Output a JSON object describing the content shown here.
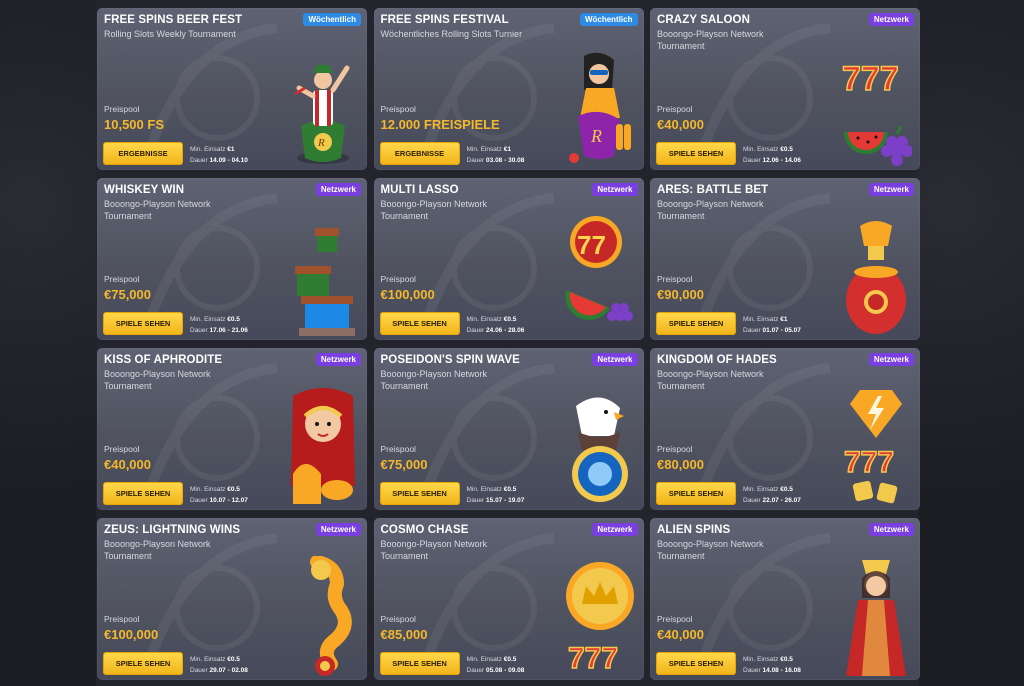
{
  "labels": {
    "pool": "Preispool",
    "min_bet": "Min. Einsatz",
    "duration": "Dauer"
  },
  "cards": [
    {
      "title": "FREE SPINS BEER FEST",
      "subtitle": "Rolling Slots Weekly Tournament",
      "badge": "Wöchentlich",
      "badge_type": "weekly",
      "pool": "10,500 FS",
      "button": "ERGEBNISSE",
      "min_bet": "€1",
      "duration": "14.09 - 04.10",
      "art": "beer-mascot"
    },
    {
      "title": "FREE SPINS FESTIVAL",
      "subtitle": "Wöchentliches Rolling Slots Turnier",
      "badge": "Wöchentlich",
      "badge_type": "weekly",
      "pool": "12.000 FREISPIELE",
      "button": "ERGEBNISSE",
      "min_bet": "€1",
      "duration": "03.08 - 30.08",
      "art": "festival-mascot"
    },
    {
      "title": "CRAZY SALOON",
      "subtitle": "Booongo-Playson Network Tournament",
      "badge": "Netzwerk",
      "badge_type": "network",
      "pool": "€40,000",
      "button": "SPIELE SEHEN",
      "min_bet": "€0.5",
      "duration": "12.06 - 14.06",
      "art": "sevens-fruits"
    },
    {
      "title": "WHISKEY WIN",
      "subtitle": "Booongo-Playson Network Tournament",
      "badge": "Netzwerk",
      "badge_type": "network",
      "pool": "€75,000",
      "button": "SPIELE SEHEN",
      "min_bet": "€0.5",
      "duration": "17.06 - 21.06",
      "art": "temple"
    },
    {
      "title": "MULTI LASSO",
      "subtitle": "Booongo-Playson Network Tournament",
      "badge": "Netzwerk",
      "badge_type": "network",
      "pool": "€100,000",
      "button": "SPIELE SEHEN",
      "min_bet": "€0.5",
      "duration": "24.06 - 28.06",
      "art": "sevens-watermelon"
    },
    {
      "title": "ARES: BATTLE BET",
      "subtitle": "Booongo-Playson Network Tournament",
      "badge": "Netzwerk",
      "badge_type": "network",
      "pool": "€90,000",
      "button": "SPIELE SEHEN",
      "min_bet": "€1",
      "duration": "01.07 - 05.07",
      "art": "dragon-vase"
    },
    {
      "title": "KISS OF APHRODITE",
      "subtitle": "Booongo-Playson Network Tournament",
      "badge": "Netzwerk",
      "badge_type": "network",
      "pool": "€40,000",
      "button": "SPIELE SEHEN",
      "min_bet": "€0.5",
      "duration": "10.07 - 12.07",
      "art": "goddess"
    },
    {
      "title": "POSEIDON'S SPIN WAVE",
      "subtitle": "Booongo-Playson Network Tournament",
      "badge": "Netzwerk",
      "badge_type": "network",
      "pool": "€75,000",
      "button": "SPIELE SEHEN",
      "min_bet": "€0.5",
      "duration": "15.07 - 19.07",
      "art": "eagle-orb"
    },
    {
      "title": "KINGDOM OF HADES",
      "subtitle": "Booongo-Playson Network Tournament",
      "badge": "Netzwerk",
      "badge_type": "network",
      "pool": "€80,000",
      "button": "SPIELE SEHEN",
      "min_bet": "€0.5",
      "duration": "22.07 - 26.07",
      "art": "lightning-sevens"
    },
    {
      "title": "ZEUS: LIGHTNING WINS",
      "subtitle": "Booongo-Playson Network Tournament",
      "badge": "Netzwerk",
      "badge_type": "network",
      "pool": "€100,000",
      "button": "SPIELE SEHEN",
      "min_bet": "€0.5",
      "duration": "29.07 - 02.08",
      "art": "golden-dragon"
    },
    {
      "title": "COSMO CHASE",
      "subtitle": "Booongo-Playson Network Tournament",
      "badge": "Netzwerk",
      "badge_type": "network",
      "pool": "€85,000",
      "button": "SPIELE SEHEN",
      "min_bet": "€0.5",
      "duration": "05.08 - 09.08",
      "art": "crown-coin"
    },
    {
      "title": "ALIEN SPINS",
      "subtitle": "Booongo-Playson Network Tournament",
      "badge": "Netzwerk",
      "badge_type": "network",
      "pool": "€40,000",
      "button": "SPIELE SEHEN",
      "min_bet": "€0.5",
      "duration": "14.08 - 16.08",
      "art": "empress"
    }
  ]
}
